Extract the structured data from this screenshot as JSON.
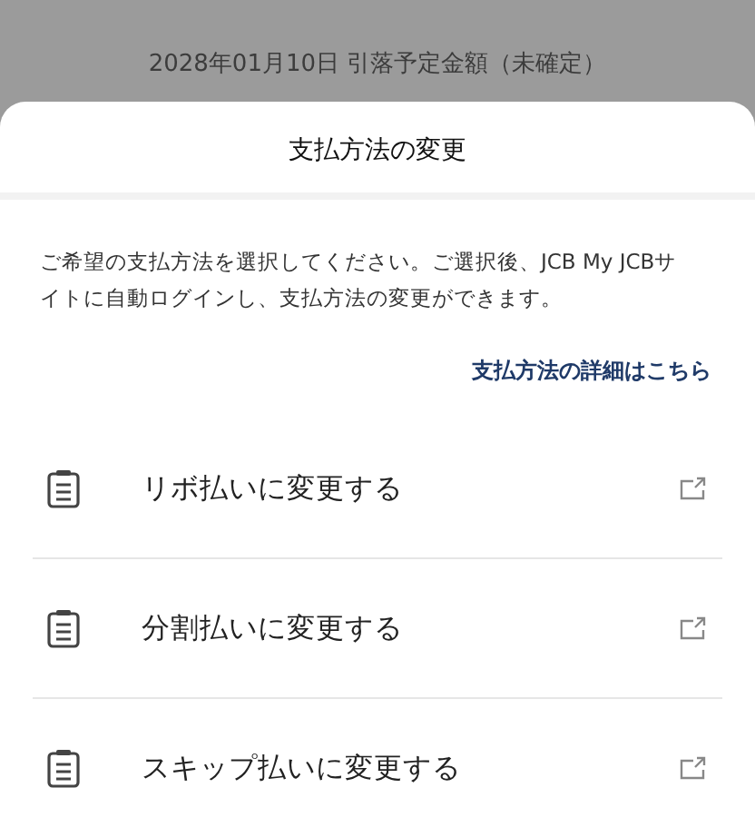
{
  "background": {
    "date_label": "2028年01月10日 引落予定金額（未確定）"
  },
  "sheet": {
    "title": "支払方法の変更",
    "description": "ご希望の支払方法を選択してください。ご選択後、JCB My JCBサイトに自動ログインし、支払方法の変更ができます。",
    "link": "支払方法の詳細はこちら",
    "options": [
      {
        "label": "リボ払いに変更する"
      },
      {
        "label": "分割払いに変更する"
      },
      {
        "label": "スキップ払いに変更する"
      }
    ]
  }
}
